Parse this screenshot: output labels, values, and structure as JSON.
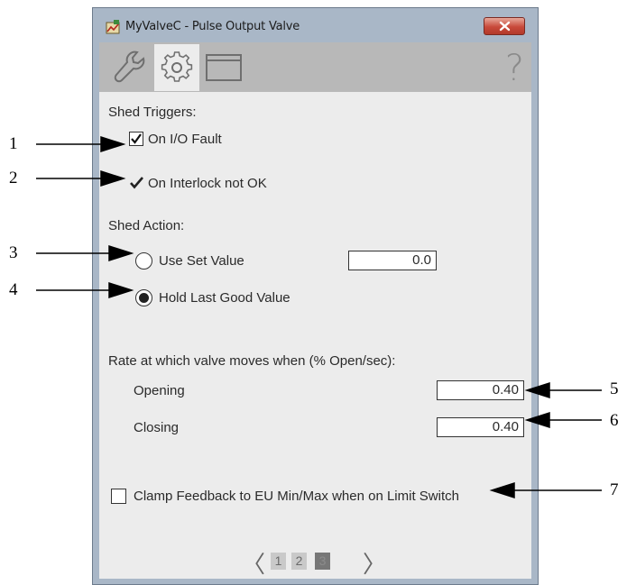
{
  "window": {
    "title": "MyValveC - Pulse Output Valve"
  },
  "toolbar": {
    "tabs": [
      {
        "icon": "wrench-icon"
      },
      {
        "icon": "gear-icon",
        "active": true
      },
      {
        "icon": "window-icon"
      }
    ],
    "help_label": "?"
  },
  "shed_triggers": {
    "heading": "Shed Triggers:",
    "io_fault": {
      "label": "On I/O Fault",
      "checked": true
    },
    "interlock": {
      "label": "On Interlock not OK",
      "checked": true
    }
  },
  "shed_action": {
    "heading": "Shed Action:",
    "use_set_value": {
      "label": "Use Set Value",
      "selected": false,
      "value": "0.0"
    },
    "hold_last_good": {
      "label": "Hold Last Good Value",
      "selected": true
    }
  },
  "rate": {
    "heading": "Rate at which valve moves when (% Open/sec):",
    "opening": {
      "label": "Opening",
      "value": "0.40"
    },
    "closing": {
      "label": "Closing",
      "value": "0.40"
    }
  },
  "clamp": {
    "label": "Clamp Feedback to EU Min/Max when on Limit Switch",
    "checked": false
  },
  "pager": {
    "prev": "〈",
    "next": "〉",
    "pages": [
      "1",
      "2",
      "3"
    ],
    "current": "3"
  },
  "callouts": [
    "1",
    "2",
    "3",
    "4",
    "5",
    "6",
    "7"
  ]
}
